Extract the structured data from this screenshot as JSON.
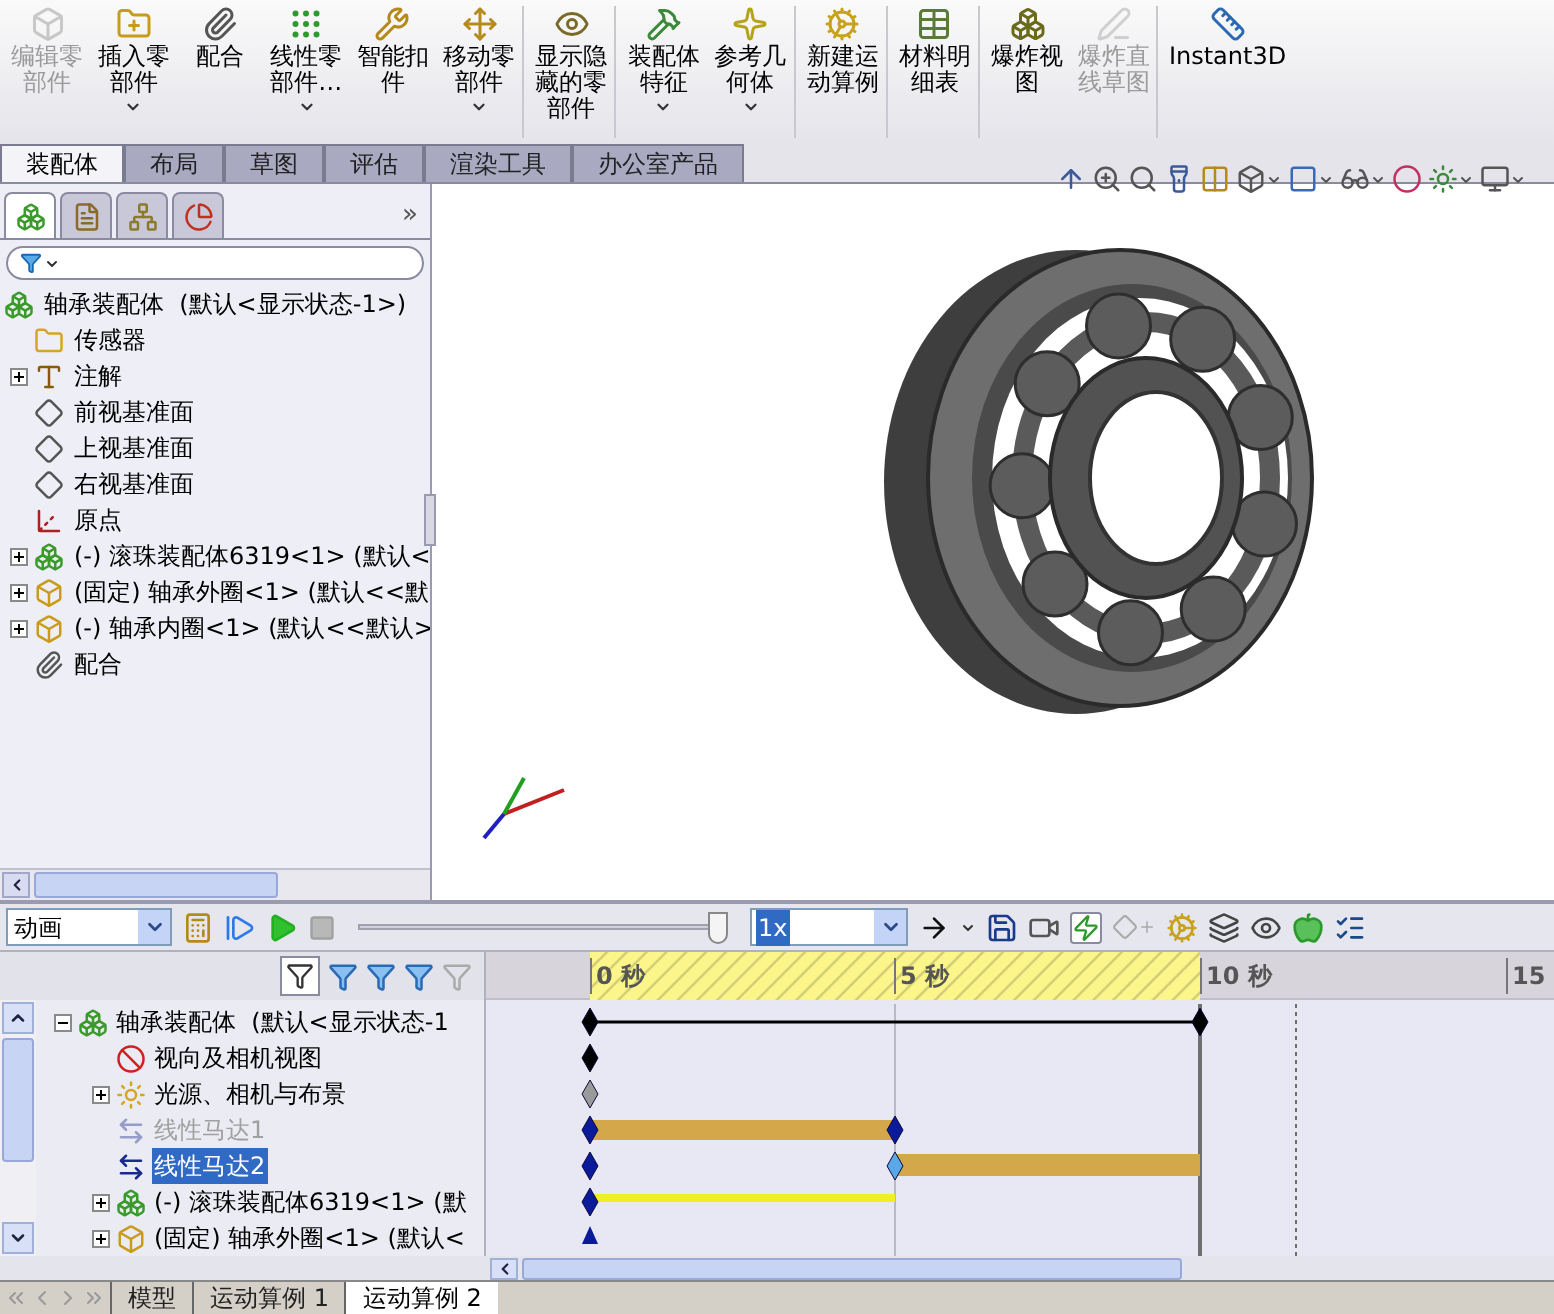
{
  "toolbar": {
    "buttons": [
      {
        "label": "编辑零部件",
        "kind": "edit",
        "disabled": true,
        "dropdown": false,
        "separator_after": false
      },
      {
        "label": "插入零部件",
        "kind": "insert",
        "disabled": false,
        "dropdown": true,
        "separator_after": false
      },
      {
        "label": "配合",
        "kind": "mate",
        "disabled": false,
        "dropdown": false,
        "separator_after": false
      },
      {
        "label": "线性零部件…",
        "kind": "pattern",
        "disabled": false,
        "dropdown": true,
        "separator_after": false
      },
      {
        "label": "智能扣件",
        "kind": "fastener",
        "disabled": false,
        "dropdown": false,
        "separator_after": false
      },
      {
        "label": "移动零部件",
        "kind": "move",
        "disabled": false,
        "dropdown": true,
        "separator_after": true
      },
      {
        "label": "显示隐藏的零部件",
        "kind": "show",
        "disabled": false,
        "dropdown": false,
        "separator_after": true
      },
      {
        "label": "装配体特征",
        "kind": "feature",
        "disabled": false,
        "dropdown": true,
        "separator_after": false
      },
      {
        "label": "参考几何体",
        "kind": "reference",
        "disabled": false,
        "dropdown": true,
        "separator_after": true
      },
      {
        "label": "新建运动算例",
        "kind": "motion",
        "disabled": false,
        "dropdown": false,
        "separator_after": true
      },
      {
        "label": "材料明细表",
        "kind": "bom",
        "disabled": false,
        "dropdown": false,
        "separator_after": true
      },
      {
        "label": "爆炸视图",
        "kind": "explode",
        "disabled": false,
        "dropdown": false,
        "separator_after": false
      },
      {
        "label": "爆炸直线草图",
        "kind": "sketch",
        "disabled": true,
        "dropdown": false,
        "separator_after": true
      },
      {
        "label": "Instant3D",
        "kind": "instant3d",
        "disabled": false,
        "dropdown": false,
        "separator_after": false
      }
    ]
  },
  "tabs": [
    {
      "label": "装配体",
      "selected": true
    },
    {
      "label": "布局",
      "selected": false
    },
    {
      "label": "草图",
      "selected": false
    },
    {
      "label": "评估",
      "selected": false
    },
    {
      "label": "渲染工具",
      "selected": false
    },
    {
      "label": "办公室产品",
      "selected": false
    }
  ],
  "feature_manager": {
    "tabs": [
      {
        "kind": "features",
        "selected": true
      },
      {
        "kind": "properties",
        "selected": false
      },
      {
        "kind": "config",
        "selected": false
      },
      {
        "kind": "display",
        "selected": false
      }
    ],
    "more": "»",
    "tree": [
      {
        "label": "轴承装配体  (默认<显示状态-1>)",
        "kind": "assembly",
        "children": [
          {
            "label": "传感器",
            "kind": "sensor"
          },
          {
            "label": "注解",
            "kind": "annotation",
            "expanded": false
          },
          {
            "label": "前视基准面",
            "kind": "plane"
          },
          {
            "label": "上视基准面",
            "kind": "plane"
          },
          {
            "label": "右视基准面",
            "kind": "plane"
          },
          {
            "label": "原点",
            "kind": "origin"
          },
          {
            "label": "(-) 滚珠装配体6319<1> (默认<",
            "kind": "assembly",
            "expanded": false
          },
          {
            "label": "(固定) 轴承外圈<1> (默认<<默",
            "kind": "part",
            "expanded": false
          },
          {
            "label": "(-) 轴承内圈<1> (默认<<默认>",
            "kind": "part",
            "expanded": false
          },
          {
            "label": "配合",
            "kind": "mates"
          }
        ]
      }
    ]
  },
  "motion_study": {
    "type_select": {
      "value": "动画"
    },
    "playback_slider": {
      "level": 1
    },
    "speed_select": {
      "value": "1x"
    },
    "tree": [
      {
        "label": "轴承装配体  (默认<显示状态-1",
        "kind": "assembly",
        "expanded": true,
        "selected": false,
        "disabled": false,
        "children": [
          {
            "label": "视向及相机视图",
            "kind": "camera",
            "selected": false,
            "disabled": false
          },
          {
            "label": "光源、相机与布景",
            "kind": "lights",
            "expanded": false,
            "selected": false,
            "disabled": false
          },
          {
            "label": "线性马达1",
            "kind": "motor",
            "selected": false,
            "disabled": true
          },
          {
            "label": "线性马达2",
            "kind": "motor",
            "selected": true,
            "disabled": false
          },
          {
            "label": "(-) 滚珠装配体6319<1> (默",
            "kind": "assembly",
            "expanded": false,
            "selected": false,
            "disabled": false
          },
          {
            "label": "(固定) 轴承外圈<1> (默认<",
            "kind": "part",
            "expanded": false,
            "selected": false,
            "disabled": false
          }
        ]
      }
    ],
    "timeline": {
      "ruler_labels": [
        "0 秒",
        "5 秒",
        "10 秒",
        "15"
      ]
    },
    "tabs": [
      {
        "label": "模型",
        "selected": false
      },
      {
        "label": "运动算例 1",
        "selected": false
      },
      {
        "label": "运动算例 2",
        "selected": true
      }
    ]
  }
}
